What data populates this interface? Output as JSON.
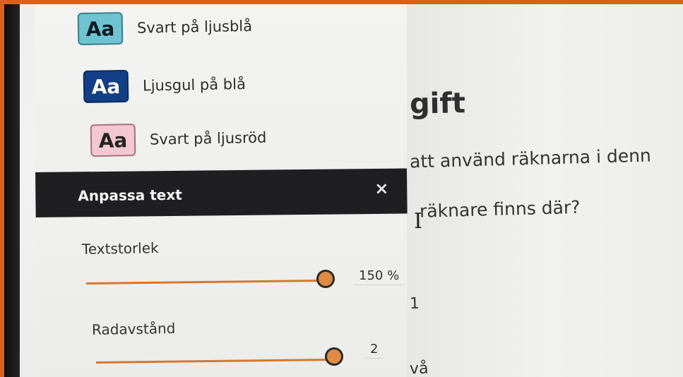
{
  "themes": [
    {
      "swatch": "Aa",
      "label": "Svart på ljusblå",
      "bg": "#6fc2cf",
      "fg": "#0d1b22"
    },
    {
      "swatch": "Aa",
      "label": "Ljusgul på blå",
      "bg": "#123f85",
      "fg": "#fffdf0"
    },
    {
      "swatch": "Aa",
      "label": "Svart på ljusröd",
      "bg": "#f3c7d3",
      "fg": "#222222"
    }
  ],
  "panel": {
    "title": "Anpassa text",
    "close_icon": "×"
  },
  "settings": {
    "text_size": {
      "label": "Textstorlek",
      "value": "150 %",
      "level": 1.0
    },
    "line_spacing": {
      "label": "Radavstånd",
      "value": "2",
      "level": 1.0
    }
  },
  "page": {
    "heading_fragment": "gift",
    "line1": "att använd räknarna i denn",
    "line2": "räknare finns där?",
    "line3": "1",
    "line4": "vå"
  },
  "colors": {
    "accent": "#d9762c",
    "panel_header_bg": "#1f1f22"
  }
}
